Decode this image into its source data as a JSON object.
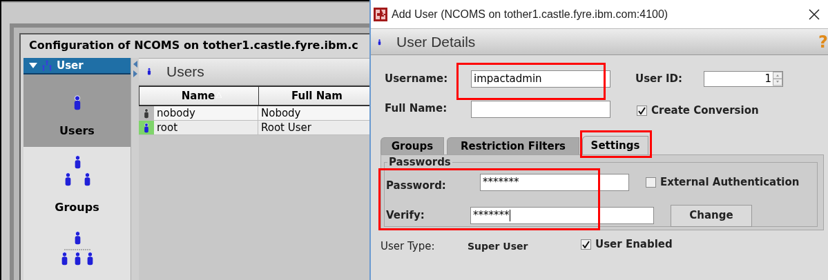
{
  "config_window": {
    "title": "Configuration of NCOMS on tother1.castle.fyre.ibm.c",
    "sidebar": {
      "header": "User",
      "expanded": true,
      "items": [
        {
          "label": "Users",
          "kind": "users",
          "selected": true
        },
        {
          "label": "Groups",
          "kind": "groups",
          "selected": false
        },
        {
          "kind": "roles",
          "selected": false
        }
      ]
    },
    "panel_title": "Users",
    "table": {
      "columns": [
        {
          "label": "Name",
          "sorted": true
        },
        {
          "label": "Full Nam",
          "sorted": false
        }
      ],
      "rows": [
        {
          "name": "nobody",
          "full_name": "Nobody",
          "enabled": false,
          "selected": false
        },
        {
          "name": "root",
          "full_name": "Root User",
          "enabled": true,
          "selected": true
        }
      ]
    }
  },
  "dialog": {
    "title": "Add User (NCOMS on tother1.castle.fyre.ibm.com:4100)",
    "header": "User Details",
    "help": "?",
    "username": {
      "label": "Username:",
      "value": "impactadmin",
      "highlighted": true
    },
    "user_id": {
      "label": "User ID:",
      "value": "1"
    },
    "full_name": {
      "label": "Full Name:"
    },
    "create_conversion": {
      "label": "Create Conversion",
      "checked": true
    },
    "tabs": [
      {
        "label": "Groups",
        "selected": false,
        "highlighted": false
      },
      {
        "label": "Restriction Filters",
        "selected": false,
        "highlighted": false
      },
      {
        "label": "Settings",
        "selected": true,
        "highlighted": true
      }
    ],
    "passwords": {
      "legend": "Passwords",
      "highlighted": true,
      "password": {
        "label": "Password:",
        "value": "*******"
      },
      "verify": {
        "label": "Verify:",
        "value": "*******"
      },
      "external_auth": {
        "label": "External Authentication",
        "checked": false
      },
      "change_button": "Change"
    },
    "user_type": {
      "label": "User Type:",
      "value": "Super User"
    },
    "user_enabled": {
      "label": "User Enabled",
      "checked": true
    }
  }
}
